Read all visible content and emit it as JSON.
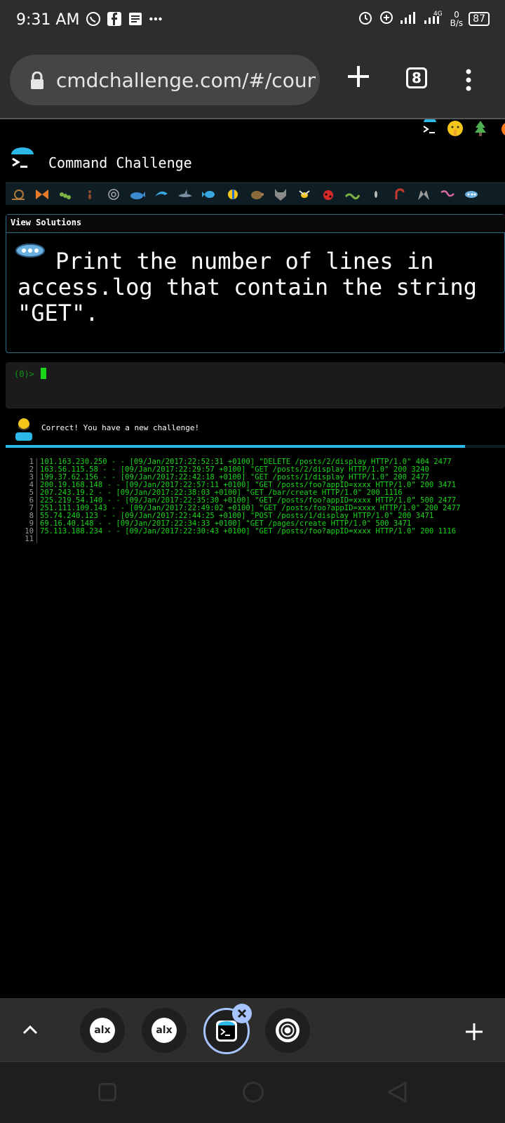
{
  "status": {
    "time": "9:31 AM",
    "battery": "87",
    "net_speed_value": "0",
    "net_speed_unit": "B/s",
    "network": "4G",
    "app_icons": [
      "whatsapp-icon",
      "facebook-icon",
      "notes-icon",
      "more-dots-icon"
    ]
  },
  "browser": {
    "url": "cmdchallenge.com/#/count_",
    "tab_count": "8"
  },
  "site": {
    "title": "Command Challenge",
    "view_solutions": "View Solutions",
    "challenge_text": "Print the number of lines in access.log that contain the string \"GET\".",
    "prompt": "(0)>",
    "message": "Correct! You have a new challenge!",
    "progress_fraction": 0.92,
    "animal_icons": [
      "snail",
      "butterfly",
      "caterpillar",
      "ant",
      "spider",
      "whale",
      "dolphin",
      "dolphin2",
      "fish",
      "tropical-fish",
      "turtle",
      "wolf",
      "bee",
      "ladybug",
      "worm",
      "bug",
      "lobster",
      "fly",
      "worm2",
      "blob"
    ]
  },
  "output_lines": [
    {
      "n": "1",
      "text": "101.163.230.250 - - [09/Jan/2017:22:52:31 +0100] \"DELETE /posts/2/display HTTP/1.0\" 404 2477"
    },
    {
      "n": "2",
      "text": "163.56.115.58 - - [09/Jan/2017:22:29:57 +0100] \"GET /posts/2/display HTTP/1.0\" 200 3240"
    },
    {
      "n": "3",
      "text": "199.37.62.156 - - [09/Jan/2017:22:42:18 +0100] \"GET /posts/1/display HTTP/1.0\" 200 2477"
    },
    {
      "n": "4",
      "text": "200.19.168.148 - - [09/Jan/2017:22:57:11 +0100] \"GET /posts/foo?appID=xxxx HTTP/1.0\" 200 3471"
    },
    {
      "n": "5",
      "text": "207.243.19.2 - - [09/Jan/2017:22:38:03 +0100] \"GET /bar/create HTTP/1.0\" 200 1116"
    },
    {
      "n": "6",
      "text": "225.219.54.140 - - [09/Jan/2017:22:35:30 +0100] \"GET /posts/foo?appID=xxxx HTTP/1.0\" 500 2477"
    },
    {
      "n": "7",
      "text": "251.111.109.143 - - [09/Jan/2017:22:49:02 +0100] \"GET /posts/foo?appID=xxxx HTTP/1.0\" 200 2477"
    },
    {
      "n": "8",
      "text": "55.74.240.123 - - [09/Jan/2017:22:44:25 +0100] \"POST /posts/1/display HTTP/1.0\" 200 3471"
    },
    {
      "n": "9",
      "text": "69.16.40.148 - - [09/Jan/2017:22:34:33 +0100] \"GET /pages/create HTTP/1.0\" 500 3471"
    },
    {
      "n": "10",
      "text": "75.113.188.234 - - [09/Jan/2017:22:30:43 +0100] \"GET /posts/foo?appID=xxxx HTTP/1.0\" 200 1116"
    },
    {
      "n": "11",
      "text": ""
    }
  ],
  "tabs": [
    {
      "label": "alx",
      "active": false
    },
    {
      "label": "alx",
      "active": false
    },
    {
      "label": "",
      "active": true
    },
    {
      "label": "",
      "active": false
    }
  ]
}
